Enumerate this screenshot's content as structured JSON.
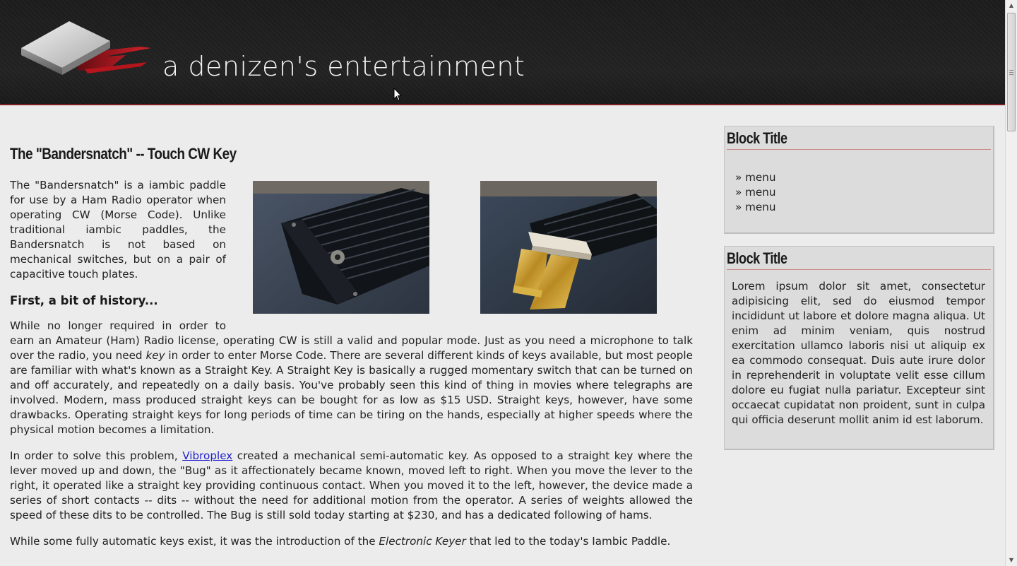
{
  "header": {
    "site_title": "a denizen's entertainment"
  },
  "article": {
    "title": "The \"Bandersnatch\" -- Touch CW Key",
    "intro": "The \"Bandersnatch\" is a iambic paddle for use by a Ham Radio operator when operating CW (Morse Code). Unlike traditional iambic paddles, the Bandersnatch is not based on mechanical switches, but on a pair of capacitive touch plates.",
    "section_heading": "First, a bit of history...",
    "para1_a": "While no longer required in order to earn an Amateur (Ham) Radio license, operating CW is still a valid and popular mode. Just as you need a microphone to talk over the radio, you need ",
    "para1_em": "key",
    "para1_b": " in order to enter Morse Code. There are several different kinds of keys available, but most people are familiar with what's known as a Straight Key. A Straight Key is basically a rugged momentary switch that can be turned on and off accurately, and repeatedly on a daily basis. You've probably seen this kind of thing in movies where telegraphs are involved. Modern, mass produced straight keys can be bought for as low as $15 USD. Straight keys, however, have some drawbacks. Operating straight keys for long periods of time can be tiring on the hands, especially at higher speeds where the physical motion becomes a limitation.",
    "para2_a": "In order to solve this problem, ",
    "para2_link": "Vibroplex",
    "para2_b": " created a mechanical semi-automatic key. As opposed to a straight key where the lever moved up and down, the \"Bug\" as it affectionately became known, moved left to right. When you move the lever to the right, it operated like a straight key providing continuous contact. When you moved it to the left, however, the device made a series of short contacts -- dits -- without the need for additional motion from the operator. A series of weights allowed the speed of these dits to be controlled. The Bug is still sold today starting at $230, and has a dedicated following of hams.",
    "para3_a": "While some fully automatic keys exist, it was the introduction of the ",
    "para3_em": "Electronic Keyer",
    "para3_b": " that led to the today's Iambic Paddle."
  },
  "sidebar": {
    "block1": {
      "title": "Block Title",
      "items": [
        "» menu",
        "» menu",
        "» menu"
      ]
    },
    "block2": {
      "title": "Block Title",
      "text": "Lorem ipsum dolor sit amet, consectetur adipisicing elit, sed do eiusmod tempor incididunt ut labore et dolore magna aliqua. Ut enim ad minim veniam, quis nostrud exercitation ullamco laboris nisi ut aliquip ex ea commodo consequat. Duis aute irure dolor in reprehenderit in voluptate velit esse cillum dolore eu fugiat nulla pariatur. Excepteur sint occaecat cupidatat non proident, sunt in culpa qui officia deserunt mollit anim id est laborum."
    }
  },
  "colors": {
    "header_bg": "#1e1e1e",
    "accent_red": "#7d1f24",
    "page_bg": "#ececec",
    "block_bg": "#dcdcdc",
    "link": "#2222cc"
  },
  "icons": {
    "logo": "ade-logo",
    "cursor": "mouse-pointer-icon",
    "scroll_up": "scroll-up-arrow-icon",
    "scroll_down": "scroll-down-arrow-icon"
  }
}
